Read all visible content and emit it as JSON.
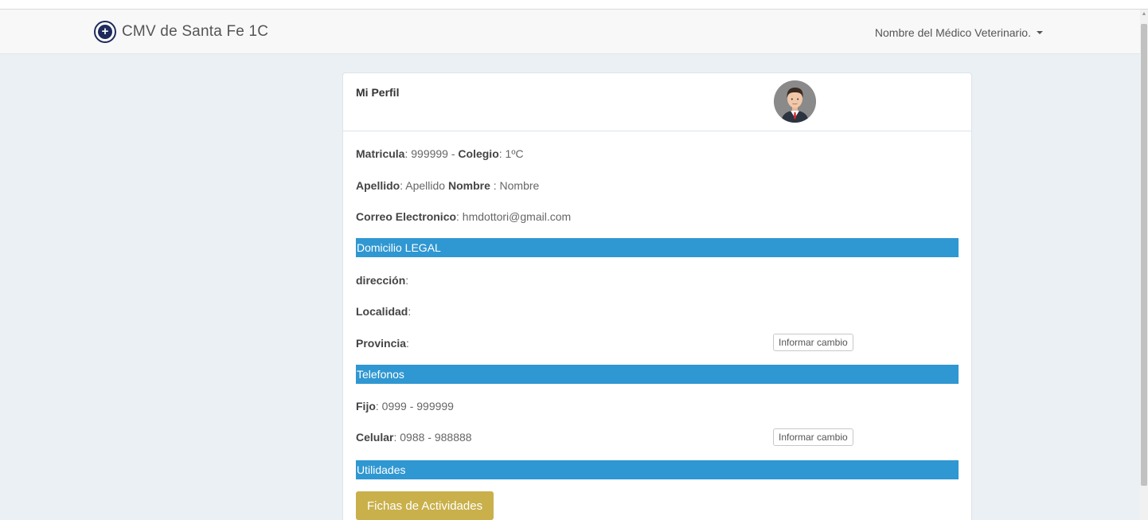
{
  "navbar": {
    "brand": "CMV de Santa Fe 1C",
    "user_menu": "Nombre del Médico Veterinario."
  },
  "panel": {
    "title": "Mi Perfil",
    "matricula_label": "Matricula",
    "matricula_value": ": 999999",
    "sep": " - ",
    "colegio_label": "Colegio",
    "colegio_value": ": 1ºC",
    "apellido_label": "Apellido",
    "apellido_value": ": Apellido ",
    "nombre_label": "Nombre",
    "nombre_value": " : Nombre",
    "correo_label": "Correo Electronico",
    "correo_value": ": hmdottori@gmail.com",
    "section_domicilio": "Domicilio LEGAL",
    "direccion_label": "dirección",
    "direccion_value": ":",
    "localidad_label": "Localidad",
    "localidad_value": ":",
    "provincia_label": "Provincia",
    "provincia_value": ":",
    "informar_cambio_1": "Informar cambio",
    "section_telefonos": "Telefonos",
    "fijo_label": "Fijo",
    "fijo_value": ": 0999 - 999999",
    "celular_label": "Celular",
    "celular_value": ": 0988 - 988888",
    "informar_cambio_2": "Informar cambio",
    "section_utilidades": "Utilidades",
    "fichas_button": "Fichas de Actividades"
  },
  "colors": {
    "section_bar": "#2f97d1",
    "gold_button": "#c9b04b",
    "background": "#ebf0f5"
  },
  "icons": {
    "logo": "cmv-logo-icon",
    "caret": "caret-down-icon",
    "avatar": "user-avatar-icon"
  }
}
